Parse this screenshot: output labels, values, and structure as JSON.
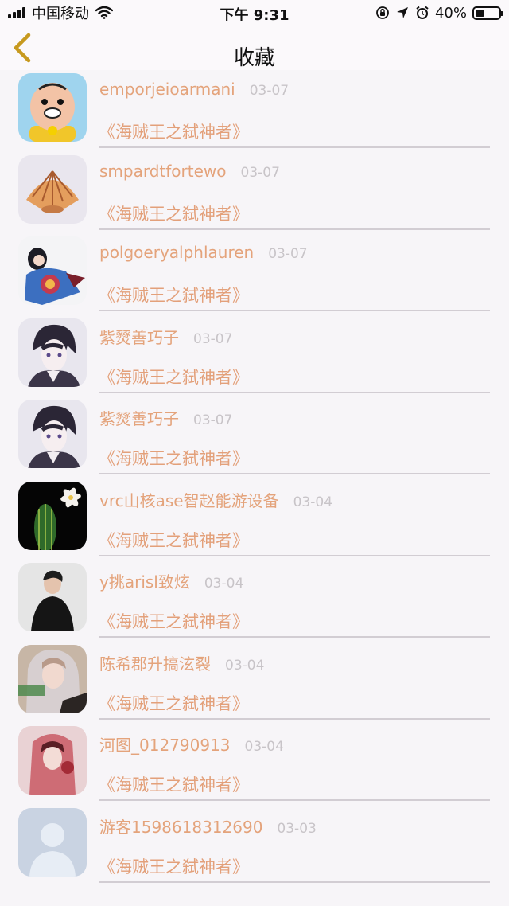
{
  "status_bar": {
    "carrier": "中国移动",
    "time": "下午 9:31",
    "battery": "40%",
    "battery_level": 0.4
  },
  "nav": {
    "title": "收藏",
    "back_icon": "chevron-left-icon"
  },
  "colors": {
    "accent": "#e4a37b",
    "date": "#c8c4c8",
    "divider": "#d2cdd3",
    "background": "#f7f5f8"
  },
  "items": [
    {
      "name": "emporjeioarmani",
      "date": "03-07",
      "work": "《海贼王之弑神者》",
      "avatar": "cartoon-face-avatar"
    },
    {
      "name": "smpardtfortewo",
      "date": "03-07",
      "work": "《海贼王之弑神者》",
      "avatar": "seashell-avatar"
    },
    {
      "name": "polgoeryalphlauren",
      "date": "03-07",
      "work": "《海贼王之弑神者》",
      "avatar": "kimono-girl-avatar"
    },
    {
      "name": "紫燹善巧子",
      "date": "03-07",
      "work": "《海贼王之弑神者》",
      "avatar": "anime-boy-avatar"
    },
    {
      "name": "紫燹善巧子",
      "date": "03-07",
      "work": "《海贼王之弑神者》",
      "avatar": "anime-boy-avatar"
    },
    {
      "name": "vrc山核ase智赵能游设备",
      "date": "03-04",
      "work": "《海贼王之弑神者》",
      "avatar": "cactus-flower-avatar"
    },
    {
      "name": "y挑arisl致炫",
      "date": "03-04",
      "work": "《海贼王之弑神者》",
      "avatar": "man-photo-avatar"
    },
    {
      "name": "陈希郡升搞泫裂",
      "date": "03-04",
      "work": "《海贼王之弑神者》",
      "avatar": "girl-photo-avatar"
    },
    {
      "name": "河图_012790913",
      "date": "03-04",
      "work": "《海贼王之弑神者》",
      "avatar": "red-veil-girl-avatar"
    },
    {
      "name": "游客1598618312690",
      "date": "03-03",
      "work": "《海贼王之弑神者》",
      "avatar": "default-user-avatar"
    }
  ]
}
